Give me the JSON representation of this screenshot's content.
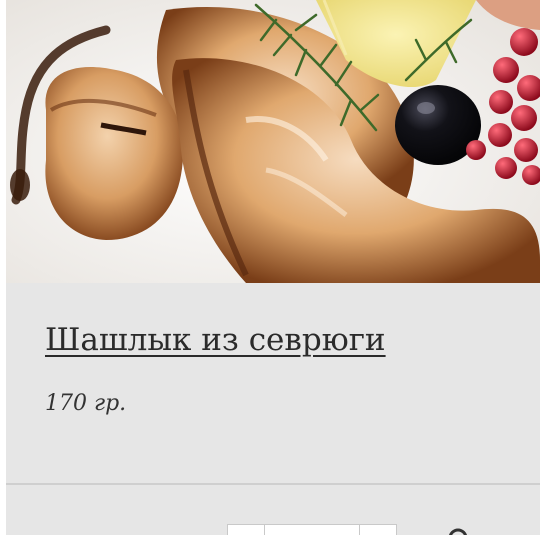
{
  "product": {
    "title": "Шашлык из севрюги",
    "weight": "170 гр."
  },
  "photo_icon": "dish-photo",
  "icons": {
    "search": "search-icon"
  },
  "colors": {
    "card_background": "#e6e6e6",
    "title_text": "#2b2b2b",
    "divider": "#cfcfcf"
  }
}
